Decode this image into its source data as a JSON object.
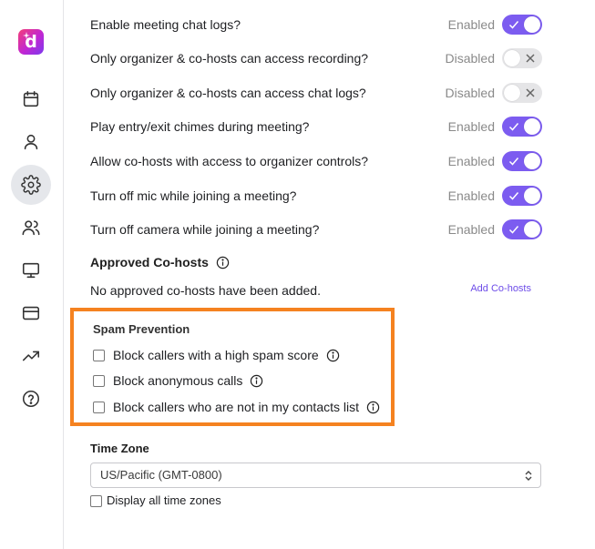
{
  "sidebar": {
    "logo_letter": "d",
    "items": [
      {
        "name": "calendar",
        "icon": "calendar-icon",
        "active": false
      },
      {
        "name": "profile",
        "icon": "user-icon",
        "active": false
      },
      {
        "name": "settings",
        "icon": "gear-icon",
        "active": true
      },
      {
        "name": "contacts",
        "icon": "users-icon",
        "active": false
      },
      {
        "name": "display",
        "icon": "monitor-icon",
        "active": false
      },
      {
        "name": "billing",
        "icon": "credit-card-icon",
        "active": false
      },
      {
        "name": "analytics",
        "icon": "trending-up-icon",
        "active": false
      },
      {
        "name": "help",
        "icon": "help-circle-icon",
        "active": false
      }
    ]
  },
  "settings": [
    {
      "label": "Enable meeting chat logs?",
      "status": "Enabled",
      "on": true
    },
    {
      "label": "Only organizer & co-hosts can access recording?",
      "status": "Disabled",
      "on": false
    },
    {
      "label": "Only organizer & co-hosts can access chat logs?",
      "status": "Disabled",
      "on": false
    },
    {
      "label": "Play entry/exit chimes during meeting?",
      "status": "Enabled",
      "on": true
    },
    {
      "label": "Allow co-hosts with access to organizer controls?",
      "status": "Enabled",
      "on": true
    },
    {
      "label": "Turn off mic while joining a meeting?",
      "status": "Enabled",
      "on": true
    },
    {
      "label": "Turn off camera while joining a meeting?",
      "status": "Enabled",
      "on": true
    }
  ],
  "cohosts": {
    "title": "Approved Co-hosts",
    "empty_text": "No approved co-hosts have been added.",
    "add_link": "Add Co-hosts"
  },
  "spam": {
    "title": "Spam Prevention",
    "options": [
      {
        "label": "Block callers with a high spam score",
        "checked": false
      },
      {
        "label": "Block anonymous calls",
        "checked": false
      },
      {
        "label": "Block callers who are not in my contacts list",
        "checked": false
      }
    ]
  },
  "timezone": {
    "title": "Time Zone",
    "value": "US/Pacific (GMT-0800)",
    "show_all_label": "Display all time zones",
    "show_all_checked": false
  },
  "colors": {
    "accent": "#7c5cf0",
    "toggle_off": "#e5e5e7",
    "highlight_border": "#f58220",
    "link": "#6d4ce8"
  }
}
